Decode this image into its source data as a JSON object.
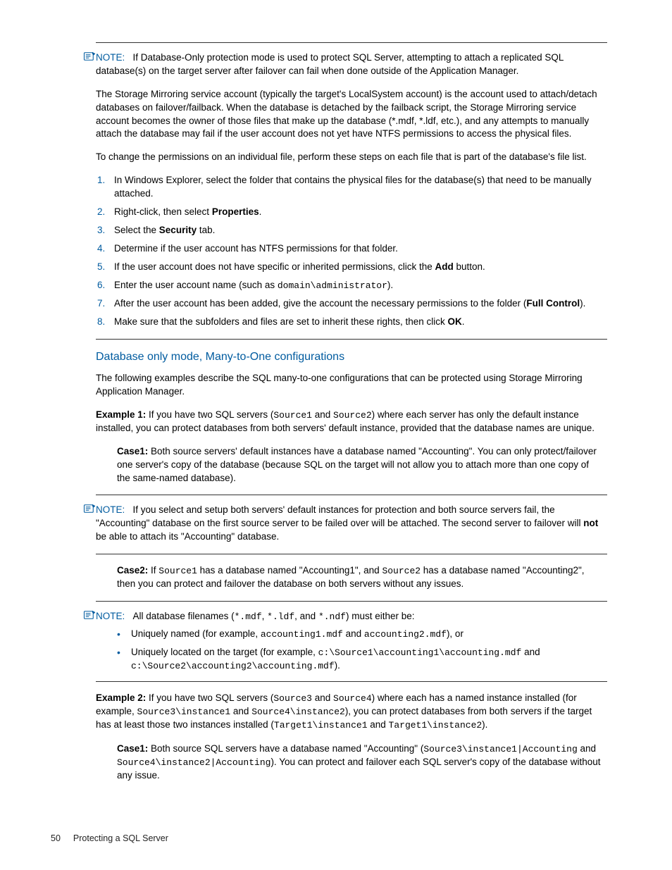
{
  "note1": {
    "label": "NOTE:",
    "p1": "If Database-Only protection mode is used to protect SQL Server, attempting to attach a replicated SQL database(s) on the target server after failover can fail when done outside of the Application Manager.",
    "p2": "The Storage Mirroring service account (typically the target's LocalSystem account) is the account used to attach/detach databases on failover/failback. When the database is detached by the failback script, the Storage Mirroring service account becomes the owner of those files that make up the database (*.mdf, *.ldf, etc.), and any attempts to manually attach the database may fail if the user account does not yet have NTFS permissions to access the physical files.",
    "p3": "To change the permissions on an individual file, perform these steps on each file that is part of the database's file list."
  },
  "steps": {
    "s1": "In Windows Explorer, select the folder that contains the physical files for the database(s) that need to be manually attached.",
    "s2a": "Right-click, then select ",
    "s2b": "Properties",
    "s2c": ".",
    "s3a": "Select the ",
    "s3b": "Security",
    "s3c": " tab.",
    "s4": "Determine if the user account has NTFS permissions for that folder.",
    "s5a": "If the user account does not have specific or inherited permissions, click the ",
    "s5b": "Add",
    "s5c": " button.",
    "s6a": "Enter the user account name (such as ",
    "s6b": "domain\\administrator",
    "s6c": ").",
    "s7a": "After the user account has been added, give the account the necessary permissions to the folder (",
    "s7b": "Full Control",
    "s7c": ").",
    "s8a": "Make sure that the subfolders and files are set to inherit these rights, then click ",
    "s8b": "OK",
    "s8c": "."
  },
  "sect_title": "Database only mode, Many-to-One configurations",
  "p_after_title": "The following examples describe the SQL many-to-one configurations that can be protected using Storage Mirroring Application Manager.",
  "ex1": {
    "label": "Example 1:",
    "a": " If you have two SQL servers (",
    "src1": "Source1",
    "mid": " and ",
    "src2": "Source2",
    "b": ") where each server has only the default instance installed, you can protect databases from both servers' default instance, provided that the database names are unique."
  },
  "case1": {
    "label": "Case1:",
    "text": " Both source servers' default instances have a database named \"Accounting\". You can only protect/failover one server's copy of the database (because SQL on the target will not allow you to attach more than one copy of the same-named database)."
  },
  "note2": {
    "label": "NOTE:",
    "a": "If you select and setup both servers' default instances for protection and both source servers fail, the \"Accounting\" database on the first source server to be failed over will be attached. The second server to failover will ",
    "not": "not",
    "b": " be able to attach its \"Accounting\" database."
  },
  "case2": {
    "label": "Case2:",
    "a": " If ",
    "s1": "Source1",
    "b": " has a database named \"Accounting1\", and ",
    "s2": "Source2",
    "c": " has a database named \"Accounting2\", then you can protect and failover the database on both servers without any issues."
  },
  "note3": {
    "label": "NOTE:",
    "a": "All database filenames (",
    "m1": "*.mdf",
    "sep1": ", ",
    "m2": "*.ldf",
    "sep2": ", and ",
    "m3": "*.ndf",
    "b": ") must either be:"
  },
  "bullets": {
    "b1a": "Uniquely named (for example, ",
    "b1m1": "accounting1.mdf",
    "b1mid": " and ",
    "b1m2": "accounting2.mdf",
    "b1end": "), or",
    "b2a": "Uniquely located on the target (for example, ",
    "b2m1": "c:\\Source1\\accounting1\\accounting.mdf",
    "b2mid": " and ",
    "b2m2": "c:\\Source2\\accounting2\\accounting.mdf",
    "b2end": ")."
  },
  "ex2": {
    "label": "Example 2:",
    "a": " If you have two SQL servers (",
    "s3": "Source3",
    "mid1": " and ",
    "s4": "Source4",
    "b": ") where each has a named instance installed (for example, ",
    "i1": "Source3\\instance1",
    "mid2": " and ",
    "i2": "Source4\\instance2",
    "c": "), you can protect databases from both servers if the target has at least those two instances installed (",
    "t1": "Target1\\instance1",
    "mid3": " and ",
    "t2": "Target1\\instance2",
    "d": ")."
  },
  "ex2case1": {
    "label": "Case1:",
    "a": " Both source SQL servers have a database named \"Accounting\" (",
    "m1": "Source3\\instance1|Accounting",
    "mid": " and ",
    "m2": "Source4\\instance2|Accounting",
    "b": "). You can protect and failover each SQL server's copy of the database without any issue."
  },
  "footer": {
    "page": "50",
    "title": "Protecting a SQL Server"
  }
}
